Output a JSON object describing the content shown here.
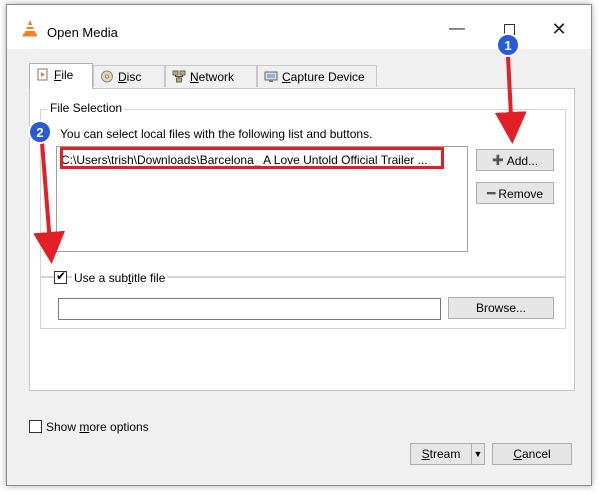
{
  "window": {
    "title": "Open Media"
  },
  "titlebar": {
    "minimize": "—",
    "close": "✕"
  },
  "tabs": [
    {
      "prefix": "",
      "key": "F",
      "rest": "ile",
      "icon": "file-icon"
    },
    {
      "prefix": "",
      "key": "D",
      "rest": "isc",
      "icon": "disc-icon"
    },
    {
      "prefix": "",
      "key": "N",
      "rest": "etwork",
      "icon": "network-icon"
    },
    {
      "prefix": "",
      "key": "C",
      "rest": "apture Device",
      "icon": "capture-device-icon"
    }
  ],
  "file_selection": {
    "legend": "File Selection",
    "hint": "You can select local files with the following list and buttons.",
    "files": [
      "C:\\Users\\trish\\Downloads\\Barcelona_ A Love Untold Official Trailer ..."
    ],
    "add_label": "Add...",
    "remove_label": "Remove"
  },
  "subtitle": {
    "label_pre": "Use a sub",
    "label_key": "t",
    "label_post": "itle file",
    "checked": true,
    "path": "",
    "browse_label": "Browse..."
  },
  "more_options": {
    "label_pre": "Show ",
    "label_key": "m",
    "label_post": "ore options",
    "checked": false
  },
  "footer": {
    "stream_key": "S",
    "stream_rest": "tream",
    "cancel_key": "C",
    "cancel_rest": "ancel"
  },
  "annotations": {
    "marker1": "1",
    "marker2": "2",
    "marker_color": "#2a5bd7",
    "arrow_color": "#e21f26"
  },
  "colors": {
    "highlight": "#e21f26",
    "window_bg": "#f0f0f0"
  }
}
